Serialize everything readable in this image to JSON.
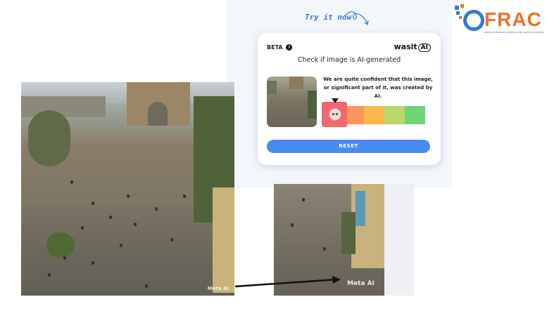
{
  "header": {
    "try_label": "Try it now"
  },
  "brand": {
    "name": "FRAC",
    "tagline": "DIGITAL FORENSICS RESEARCH AND ANALYTICS CENTRE",
    "color": "#e8732c",
    "mark_color": "#2f7ad6"
  },
  "card": {
    "beta_label": "BETA",
    "info_icon": "info-icon",
    "logo_text": "wasit",
    "logo_ai": "AI",
    "title": "Check if image is AI-generated",
    "verdict": "We are quite confident that this image, or significant part of it, was created by AI.",
    "scale_colors": [
      "#f2676b",
      "#f99758",
      "#fbb84d",
      "#b8d86a",
      "#6fd37a"
    ],
    "selected_level": 1,
    "reset_label": "RESET"
  },
  "photos": {
    "left_watermark": "Meta AI",
    "mid_watermark": "Meta AI"
  },
  "colors": {
    "accent": "#4a8bf0",
    "marker": "#f2676b"
  }
}
